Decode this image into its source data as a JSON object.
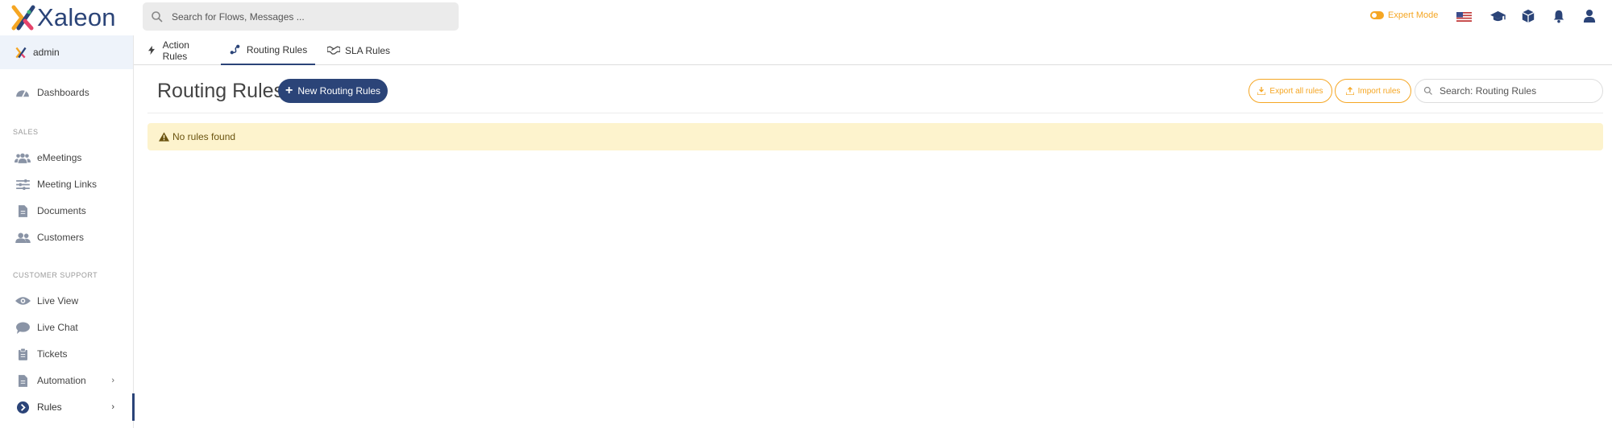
{
  "app": {
    "name": "Xaleon"
  },
  "global_search": {
    "placeholder": "Search for Flows, Messages ..."
  },
  "topbar": {
    "expert_mode_label": "Expert Mode",
    "icons": [
      "us-flag-icon",
      "graduation-cap-icon",
      "cube-icon",
      "bell-icon",
      "user-icon"
    ]
  },
  "sidebar": {
    "user": "admin",
    "dashboards": "Dashboards",
    "sales_label": "SALES",
    "sales_items": [
      "eMeetings",
      "Meeting Links",
      "Documents",
      "Customers"
    ],
    "support_label": "CUSTOMER SUPPORT",
    "support_items": [
      "Live View",
      "Live Chat",
      "Tickets",
      "Automation",
      "Rules"
    ]
  },
  "tabs": [
    "Action Rules",
    "Routing Rules",
    "SLA Rules"
  ],
  "active_tab": "Routing Rules",
  "page": {
    "title": "Routing Rules",
    "new_button": "New Routing Rules",
    "export_button": "Export all rules",
    "import_button": "Import rules",
    "search_placeholder": "Search: Routing Rules",
    "alert": "No rules found"
  },
  "colors": {
    "brand": "#2b4478",
    "accent": "#f5a623",
    "alert_bg": "#fdf3cd"
  }
}
